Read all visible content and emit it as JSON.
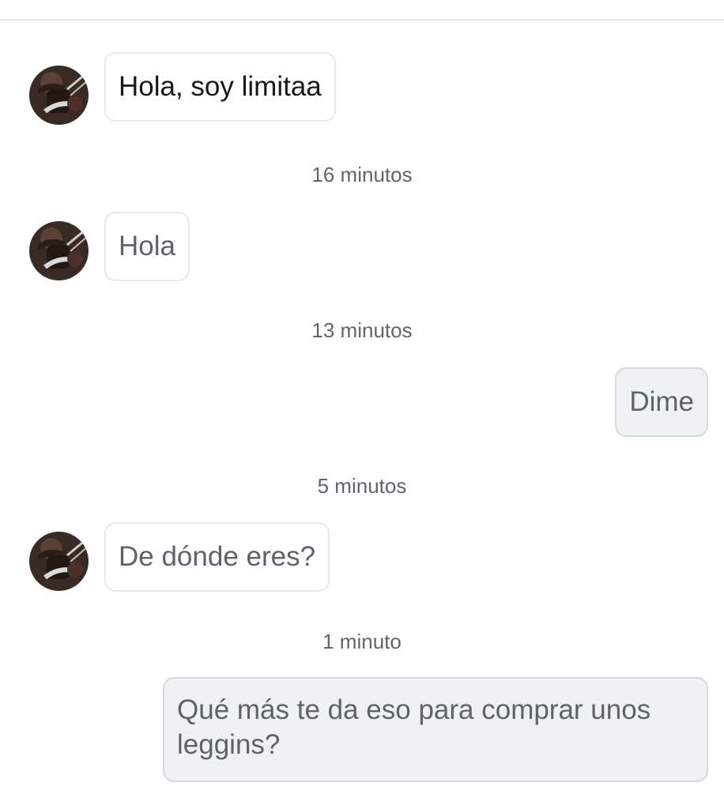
{
  "conversation": {
    "messages": [
      {
        "sender": "contact",
        "text": "Hola, soy limitaa"
      },
      {
        "time": "16 minutos"
      },
      {
        "sender": "contact",
        "text": "Hola"
      },
      {
        "time": "13 minutos"
      },
      {
        "sender": "me",
        "text": "Dime"
      },
      {
        "time": "5 minutos"
      },
      {
        "sender": "contact",
        "text": "De dónde eres?"
      },
      {
        "time": "1 minuto"
      },
      {
        "sender": "me",
        "text": "Qué más te da eso para comprar unos leggins?"
      }
    ]
  },
  "icons": {
    "avatar": "contact-avatar-photo"
  },
  "colors": {
    "own_bubble": "#eef2f3",
    "contact_bubble": "#ffffff",
    "bubble_border": "#e6e8ea",
    "text": "#5a6469",
    "timestamp": "#5e666b"
  }
}
